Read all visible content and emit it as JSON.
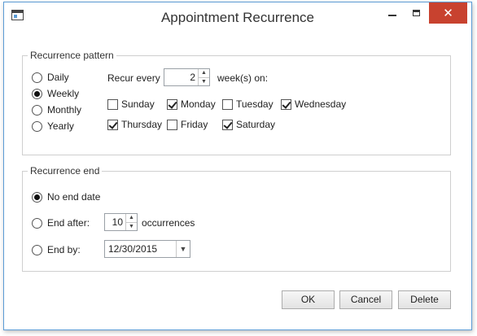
{
  "window": {
    "title": "Appointment Recurrence",
    "close_glyph": "✕"
  },
  "recurrence_pattern": {
    "legend": "Recurrence pattern",
    "frequencies": [
      {
        "label": "Daily",
        "selected": false
      },
      {
        "label": "Weekly",
        "selected": true
      },
      {
        "label": "Monthly",
        "selected": false
      },
      {
        "label": "Yearly",
        "selected": false
      }
    ],
    "recur_every_label": "Recur every",
    "recur_every_value": "2",
    "weeks_on_label": "week(s) on:",
    "days": [
      {
        "label": "Sunday",
        "checked": false
      },
      {
        "label": "Monday",
        "checked": true
      },
      {
        "label": "Tuesday",
        "checked": false
      },
      {
        "label": "Wednesday",
        "checked": true
      },
      {
        "label": "Thursday",
        "checked": true
      },
      {
        "label": "Friday",
        "checked": false
      },
      {
        "label": "Saturday",
        "checked": true
      }
    ]
  },
  "recurrence_end": {
    "legend": "Recurrence end",
    "no_end_label": "No end date",
    "end_after_label": "End after:",
    "occurrences_value": "10",
    "occurrences_label": "occurrences",
    "end_by_label": "End by:",
    "end_by_date": "12/30/2015",
    "selected": "no_end"
  },
  "buttons": {
    "ok": "OK",
    "cancel": "Cancel",
    "delete": "Delete"
  },
  "colors": {
    "window_border": "#5b9bd5",
    "close_button": "#c8422f"
  },
  "icons": {
    "app": "app-window-icon",
    "minimize": "minimize-icon",
    "maximize": "maximize-icon",
    "close": "close-icon",
    "spin": "spin-arrows-icon",
    "dropdown": "chevron-down-icon"
  }
}
